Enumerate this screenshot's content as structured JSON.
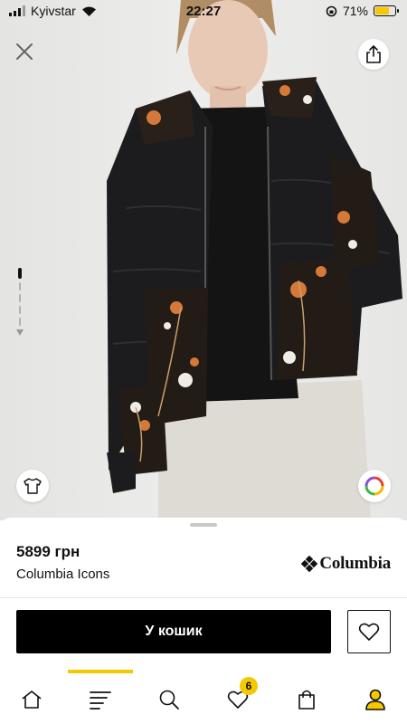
{
  "status_bar": {
    "carrier": "Kyivstar",
    "time": "22:27",
    "battery_percent": "71%",
    "battery_level": 0.71,
    "icons": [
      "signal-icon",
      "wifi-icon",
      "orientation-lock-icon",
      "battery-icon"
    ]
  },
  "gallery": {
    "image_count": 6,
    "active_index": 1,
    "icons": [
      "close-icon",
      "share-icon",
      "tshirt-icon",
      "color-picker-icon"
    ]
  },
  "product": {
    "price": "5899 грн",
    "name": "Columbia Icons",
    "brand_logo_text": "Columbia"
  },
  "actions": {
    "add_to_cart_label": "У кошик",
    "favorite_icon": "heart-icon"
  },
  "tabbar": {
    "active_tab": "catalog",
    "favorites_badge": "6",
    "tabs": [
      "home",
      "catalog",
      "search",
      "favorites",
      "cart",
      "profile"
    ]
  },
  "colors": {
    "accent": "#f6c800",
    "button_dark": "#000000",
    "background": "#ffffff"
  }
}
